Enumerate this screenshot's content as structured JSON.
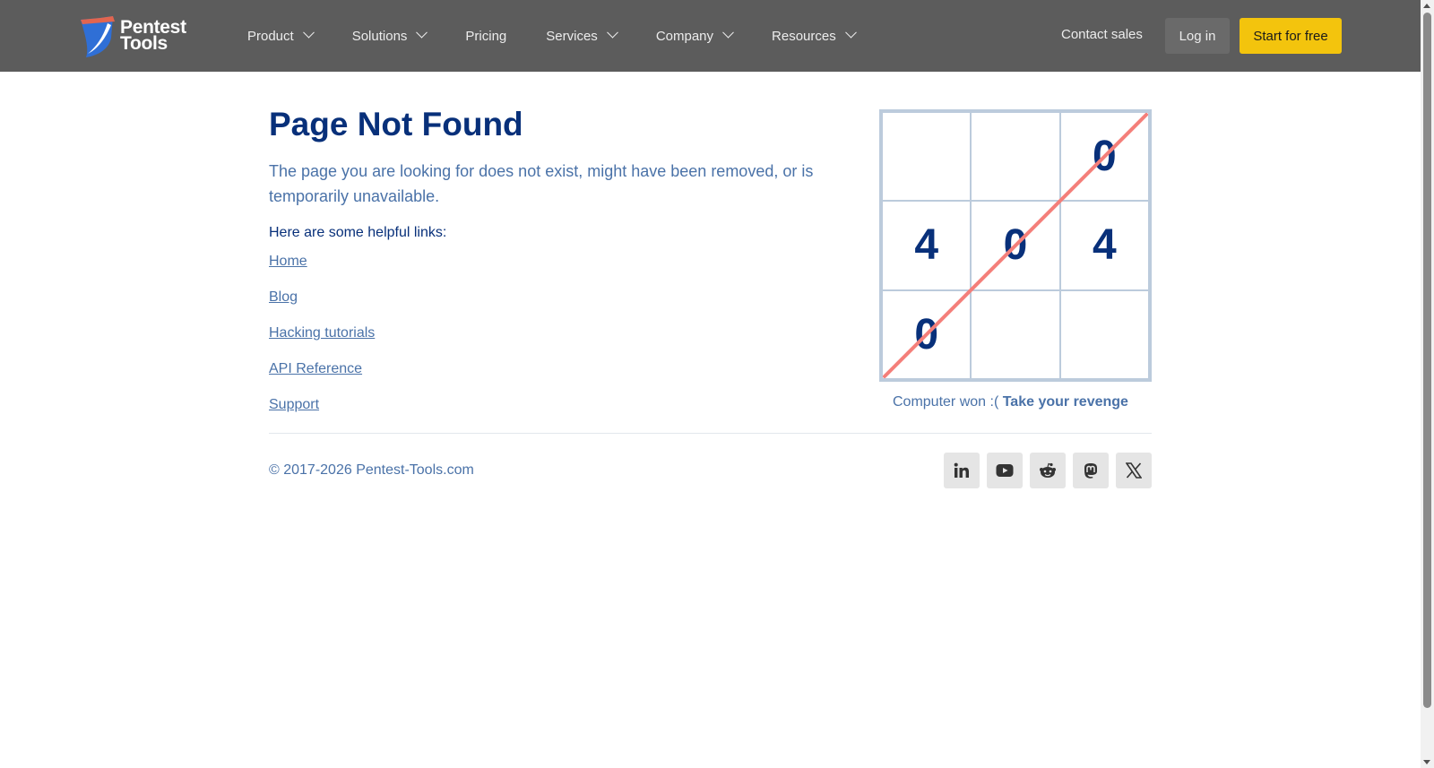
{
  "header": {
    "logo_line1": "Pentest",
    "logo_line2": "Tools",
    "nav": [
      {
        "label": "Product",
        "has_dropdown": true
      },
      {
        "label": "Solutions",
        "has_dropdown": true
      },
      {
        "label": "Pricing",
        "has_dropdown": false
      },
      {
        "label": "Services",
        "has_dropdown": true
      },
      {
        "label": "Company",
        "has_dropdown": true
      },
      {
        "label": "Resources",
        "has_dropdown": true
      }
    ],
    "contact_sales": "Contact sales",
    "login": "Log in",
    "start_free": "Start for free"
  },
  "main": {
    "title": "Page Not Found",
    "description": "The page you are looking for does not exist, might have been removed, or is temporarily unavailable.",
    "links_heading": "Here are some helpful links:",
    "links": [
      "Home",
      "Blog",
      "Hacking tutorials",
      "API Reference",
      "Support"
    ]
  },
  "game": {
    "cells": [
      "",
      "",
      "0",
      "4",
      "0",
      "4",
      "0",
      "",
      ""
    ],
    "status_text": "Computer won :(",
    "revenge_label": "Take your revenge",
    "line_color": "#f47f7a"
  },
  "footer": {
    "copyright": "© 2017-2026 Pentest-Tools.com",
    "socials": [
      "linkedin-icon",
      "youtube-icon",
      "reddit-icon",
      "mastodon-icon",
      "x-icon"
    ]
  },
  "colors": {
    "header_bg": "#5c5c5c",
    "accent": "#f3c40d",
    "primary_text": "#08307a",
    "secondary_text": "#4a72a8"
  }
}
